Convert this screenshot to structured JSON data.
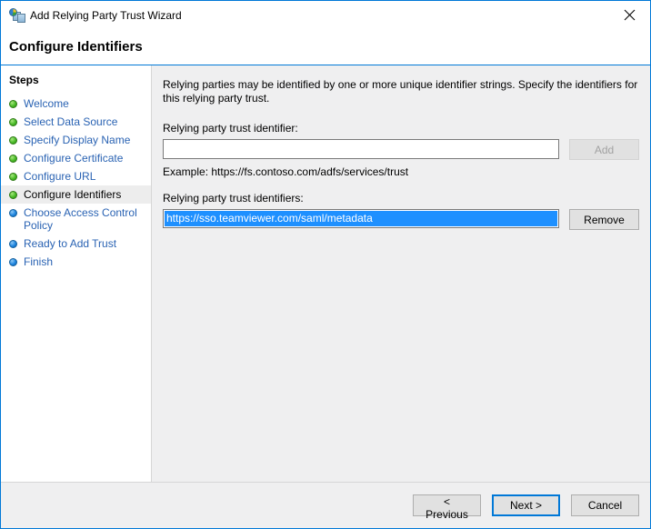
{
  "window": {
    "title": "Add Relying Party Trust Wizard",
    "icon": "trust-relationship-icon",
    "close_label": "✕",
    "border_color": "#0078d7"
  },
  "header": {
    "page_title": "Configure Identifiers",
    "accent_color": "#0078d7"
  },
  "sidebar": {
    "title": "Steps",
    "items": [
      {
        "label": "Welcome",
        "state": "done"
      },
      {
        "label": "Select Data Source",
        "state": "done"
      },
      {
        "label": "Specify Display Name",
        "state": "done"
      },
      {
        "label": "Configure Certificate",
        "state": "done"
      },
      {
        "label": "Configure URL",
        "state": "done"
      },
      {
        "label": "Configure Identifiers",
        "state": "current"
      },
      {
        "label": "Choose Access Control Policy",
        "state": "todo"
      },
      {
        "label": "Ready to Add Trust",
        "state": "todo"
      },
      {
        "label": "Finish",
        "state": "todo"
      }
    ],
    "done_color": "#49bb27",
    "todo_color": "#1e86e0",
    "link_color": "#2a63b3"
  },
  "main": {
    "intro": "Relying parties may be identified by one or more unique identifier strings. Specify the identifiers for this relying party trust.",
    "identifier_field": {
      "label": "Relying party trust identifier:",
      "value": "",
      "placeholder": ""
    },
    "add_button": {
      "label": "Add",
      "enabled": false
    },
    "example": "Example: https://fs.contoso.com/adfs/services/trust",
    "identifiers_list": {
      "label": "Relying party trust identifiers:",
      "items": [
        {
          "value": "https://sso.teamviewer.com/saml/metadata",
          "selected": true
        }
      ],
      "selection_color": "#1e90ff"
    },
    "remove_button": {
      "label": "Remove",
      "enabled": true
    }
  },
  "footer": {
    "previous_label": "< Previous",
    "next_label": "Next >",
    "cancel_label": "Cancel",
    "default_button": "next"
  }
}
